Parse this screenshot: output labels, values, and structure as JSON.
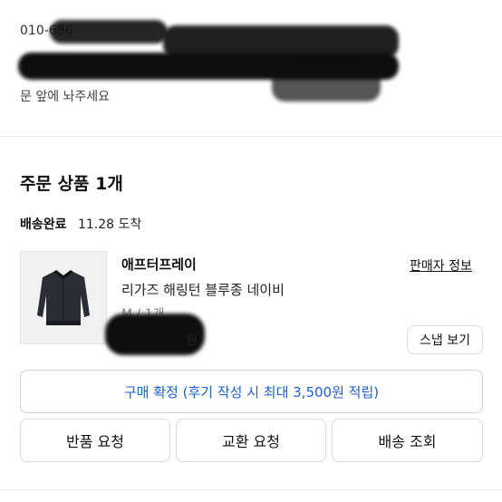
{
  "address": {
    "phone_partial": "010-686",
    "line_partial": "문 앞에 놔주세요"
  },
  "section_title": "주문 상품 1개",
  "delivery": {
    "status": "배송완료",
    "date_text": "11.28 도착"
  },
  "product": {
    "brand": "애프터프레이",
    "name": "리가즈 해링턴 블루종 네이비",
    "option": "M / 1개",
    "price_partial": "원",
    "seller_link": "판매자 정보",
    "snapshot_button": "스냅 보기",
    "image_icon": "jacket-icon"
  },
  "confirm_button": "구매 확정 (후기 작성 시 최대 3,500원 적립)",
  "actions": {
    "return": "반품 요청",
    "exchange": "교환 요청",
    "tracking": "배송 조회"
  },
  "colors": {
    "accent_blue": "#1f5fd6",
    "border": "#d9d9d9"
  }
}
